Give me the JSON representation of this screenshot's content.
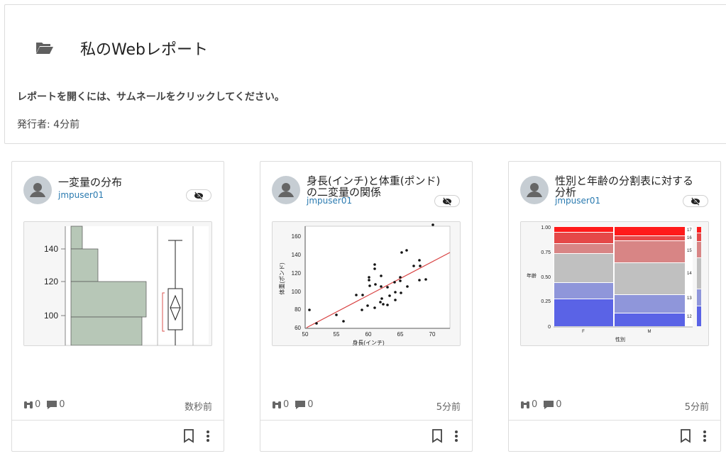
{
  "header": {
    "title": "私のWebレポート",
    "instructions": "レポートを開くには、サムネールをクリックしてください。",
    "publisher": "発行者: 4分前"
  },
  "icons": {
    "folder": "folder-open-icon",
    "avatar": "user-avatar-icon",
    "visibility": "eye-off-icon",
    "views": "binoculars-icon",
    "comments": "comment-icon",
    "bookmark": "bookmark-icon",
    "more": "more-vert-icon"
  },
  "cards": [
    {
      "title": "一変量の分布",
      "author": "jmpuser01",
      "views": "0",
      "comments": "0",
      "time": "数秒前",
      "thumbnail": {
        "type": "histogram-boxplot",
        "ticks": [
          "140",
          "120",
          "100"
        ]
      }
    },
    {
      "title": "身長(インチ)と体重(ポンド)の二変量の関係",
      "author": "jmpuser01",
      "views": "0",
      "comments": "0",
      "time": "5分前",
      "thumbnail": {
        "type": "scatter",
        "ylabel": "体重(ポンド)",
        "xlabel": "身長(インチ)",
        "yticks": [
          "160",
          "140",
          "120",
          "100",
          "80",
          "60"
        ],
        "xticks": [
          "50",
          "55",
          "60",
          "65",
          "70"
        ]
      }
    },
    {
      "title": "性別と年齢の分割表に対する分析",
      "author": "jmpuser01",
      "views": "0",
      "comments": "0",
      "time": "5分前",
      "thumbnail": {
        "type": "mosaic",
        "ylabel": "年齢",
        "xlabel": "性別",
        "yticks": [
          "1.00",
          "0.75",
          "0.50",
          "0.25",
          "0"
        ],
        "xticks": [
          "F",
          "M"
        ],
        "legend": [
          "17",
          "16",
          "15",
          "14",
          "13",
          "12"
        ]
      }
    }
  ],
  "colors": {
    "accent_link": "#2a7ab0",
    "histogram_fill": "#b7c7b7",
    "boxplot_mark": "#d9534f",
    "scatter_fit": "#d84040",
    "mosaic_high": "#ff2a2a",
    "mosaic_low": "#5a63e6"
  }
}
